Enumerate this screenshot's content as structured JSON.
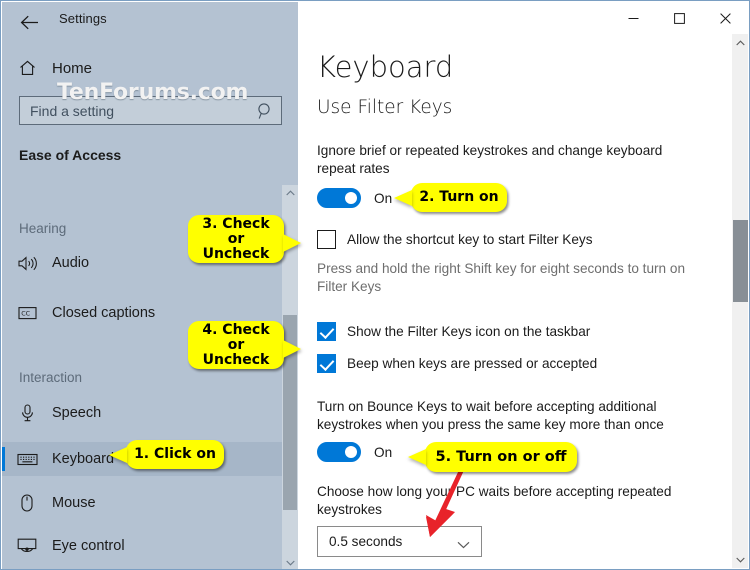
{
  "window": {
    "app_title": "Settings",
    "back_icon": "back-arrow-icon",
    "minimize_label": "─",
    "maximize_label": "□",
    "close_label": "✕"
  },
  "watermark": "TenForums.com",
  "sidebar": {
    "home_label": "Home",
    "home_icon": "home-icon",
    "search": {
      "placeholder": "Find a setting",
      "icon": "search-icon"
    },
    "section_title": "Ease of Access",
    "groups": [
      {
        "label": "Hearing",
        "items": [
          {
            "label": "Audio",
            "icon": "speaker-icon",
            "selected": false
          },
          {
            "label": "Closed captions",
            "icon": "closed-captions-icon",
            "selected": false
          }
        ]
      },
      {
        "label": "Interaction",
        "items": [
          {
            "label": "Speech",
            "icon": "microphone-icon",
            "selected": false
          },
          {
            "label": "Keyboard",
            "icon": "keyboard-icon",
            "selected": true
          },
          {
            "label": "Mouse",
            "icon": "mouse-icon",
            "selected": false
          },
          {
            "label": "Eye control",
            "icon": "eye-control-icon",
            "selected": false
          }
        ]
      }
    ]
  },
  "main": {
    "page_title": "Keyboard",
    "section_title": "Use Filter Keys",
    "filter_keys": {
      "description": "Ignore brief or repeated keystrokes and change keyboard repeat rates",
      "toggle_state": "On",
      "toggle_on": true
    },
    "shortcut": {
      "label": "Allow the shortcut key to start Filter Keys",
      "checked": false,
      "hint": "Press and hold the right Shift key for eight seconds to turn on Filter Keys"
    },
    "checkboxes": [
      {
        "label": "Show the Filter Keys icon on the taskbar",
        "checked": true
      },
      {
        "label": "Beep when keys are pressed or accepted",
        "checked": true
      }
    ],
    "bounce_keys": {
      "description": "Turn on Bounce Keys to wait before accepting additional keystrokes when you press the same key more than once",
      "toggle_state": "On",
      "toggle_on": true
    },
    "wait_time": {
      "description": "Choose how long your PC waits before accepting repeated keystrokes",
      "selected": "0.5 seconds",
      "chevron_icon": "chevron-down-icon"
    }
  },
  "callouts": [
    {
      "id": "1",
      "text": "1. Click on"
    },
    {
      "id": "2",
      "text": "2. Turn on"
    },
    {
      "id": "3",
      "text": "3. Check or Uncheck"
    },
    {
      "id": "4",
      "text": "4. Check or Uncheck"
    },
    {
      "id": "5",
      "text": "5. Turn on or off"
    }
  ],
  "colors": {
    "accent": "#0078d7",
    "callout": "#ffff00",
    "arrow": "#e8232a",
    "sidebar_bg": "#b4c2d2"
  }
}
